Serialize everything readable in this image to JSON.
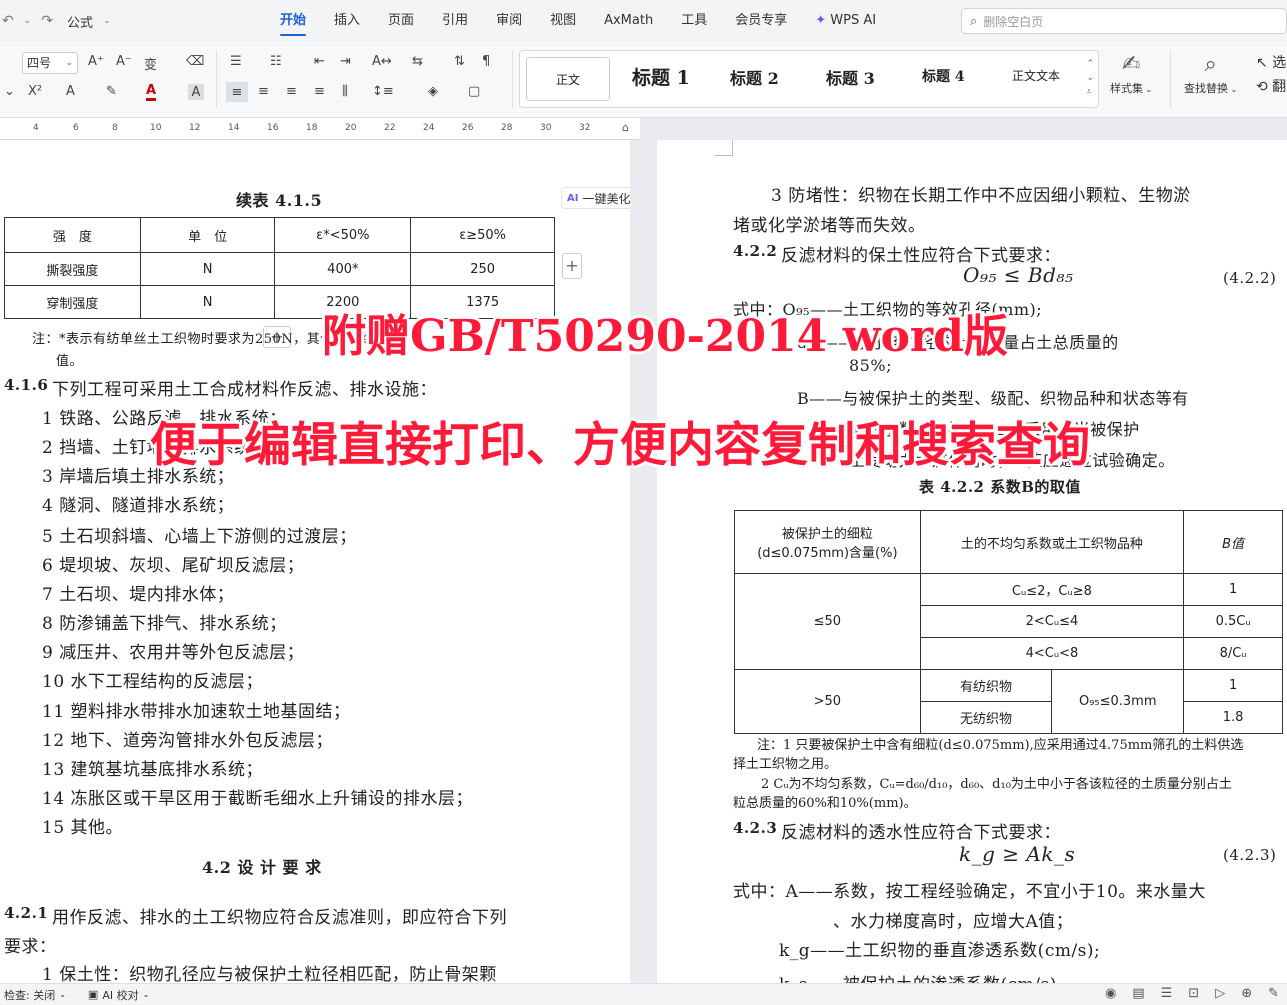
{
  "menubar": {
    "quick_style": "公式",
    "tabs": [
      "开始",
      "插入",
      "页面",
      "引用",
      "审阅",
      "视图",
      "AxMath",
      "工具",
      "会员专享",
      "WPS AI"
    ],
    "active_tab": "开始",
    "search_placeholder": "删除空白页"
  },
  "ribbon": {
    "font_size": "四号",
    "styles": [
      "正文",
      "标题 1",
      "标题 2",
      "标题 3",
      "标题 4",
      "正文文本"
    ],
    "style_set_label": "样式集",
    "find_replace_label": "查找替换",
    "select_label": "选"
  },
  "ruler": {
    "ticks": [
      "4",
      "6",
      "8",
      "10",
      "12",
      "14",
      "16",
      "18",
      "20",
      "22",
      "24",
      "26",
      "28",
      "30",
      "32"
    ]
  },
  "left_page": {
    "table_title": "续表 4.1.5",
    "ai_beautify": "一键美化",
    "table": {
      "headers": [
        "强　度",
        "单　位",
        "ε*<50%",
        "ε≥50%"
      ],
      "rows": [
        [
          "撕裂强度",
          "N",
          "400*",
          "250"
        ],
        [
          "穿制强度",
          "N",
          "2200",
          "1375"
        ]
      ]
    },
    "note_line1": "注：*表示有纺单丝土工织物时要求为250N，其他土工织物…",
    "note_line2": "值。",
    "clause_416_num": "4.1.6",
    "clause_416_text": "下列工程可采用土工合成材料作反滤、排水设施：",
    "items": [
      "1 铁路、公路反滤、排水系统；",
      "2 挡墙、土钉墙等排水系统；",
      "3 岸墙后填土排水系统；",
      "4 隧洞、隧道排水系统；",
      "5 土石坝斜墙、心墙上下游侧的过渡层；",
      "6 堤坝坡、灰坝、尾矿坝反滤层；",
      "7 土石坝、堤内排水体；",
      "8 防渗铺盖下排气、排水系统；",
      "9 减压井、农用井等外包反滤层；",
      "10 水下工程结构的反滤层；",
      "11 塑料排水带排水加速软土地基固结；",
      "12 地下、道旁沟管排水外包反滤层；",
      "13 建筑基坑基底排水系统；",
      "14 冻胀区或干旱区用于截断毛细水上升铺设的排水层；",
      "15 其他。"
    ],
    "section_42": "4.2 设 计 要 求",
    "clause_421_num": "4.2.1",
    "clause_421_text": "用作反滤、排水的土工织物应符合反滤准则，即应符合下列",
    "clause_421_cont": "要求：",
    "item_1": "1 保土性：织物孔径应与被保护土粒径相匹配，防止骨架颗"
  },
  "right_page": {
    "item_3": "3 防堵性：织物在长期工作中不应因细小颗粒、生物淤",
    "item_3_cont": "堵或化学淤堵等而失效。",
    "clause_422_num": "4.2.2",
    "clause_422_text": "反滤材料的保土性应符合下式要求：",
    "formula_422": "O₉₅ ≤ Bd₈₅",
    "formula_422_num": "(4.2.2)",
    "where_1": "式中：O₉₅——土工织物的等效孔径(mm);",
    "where_2": "d₈₅——小于该粒径的土粒质量占土总质量的",
    "where_2_cont": "85%;",
    "where_3": "B——与被保护土的类型、级配、织物品种和状态等有",
    "where_3_cont": "关的系数，应按表4.2.2采用。当被保护",
    "where_3_cont2": "土受动力水流作用时，B值应通过试验确定。",
    "table_title": "表 4.2.2  系数B的取值",
    "table": {
      "h1": "被保护土的细粒",
      "h1b": "(d≤0.075mm)含量(%)",
      "h2": "土的不均匀系数或土工织物品种",
      "h3": "B值",
      "le50": "≤50",
      "gt50": ">50",
      "r1": "Cᵤ≤2，Cᵤ≥8",
      "r1v": "1",
      "r2": "2<Cᵤ≤4",
      "r2v": "0.5Cᵤ",
      "r3": "4<Cᵤ<8",
      "r3v": "8/Cᵤ",
      "woven": "有纺织物",
      "nonwoven": "无纺织物",
      "o95": "O₉₅≤0.3mm",
      "r4v": "1",
      "r5v": "1.8"
    },
    "note_1": "注：1 只要被保护土中含有细粒(d≤0.075mm),应采用通过4.75mm筛孔的土料供选",
    "note_1_cont": "择土工织物之用。",
    "note_2": "2 Cᵤ为不均匀系数，Cᵤ=d₆₀/d₁₀，d₆₀、d₁₀为土中小于各该粒径的土质量分别占土",
    "note_2_cont": "粒总质量的60%和10%(mm)。",
    "clause_423_num": "4.2.3",
    "clause_423_text": "反滤材料的透水性应符合下式要求：",
    "formula_423": "k_g ≥ Ak_s",
    "formula_423_num": "(4.2.3)",
    "where_4": "式中：A——系数，按工程经验确定，不宜小于10。来水量大",
    "where_4_cont": "、水力梯度高时，应增大A值；",
    "where_5": "k_g——土工织物的垂直渗透系数(cm/s);",
    "where_6": "k_s——被保护土的渗透系数(cm/s)。"
  },
  "overlay": {
    "line1": "附赠GB/T50290-2014 word版",
    "line2": "便于编辑直接打印、方便内容复制和搜索查询"
  },
  "statusbar": {
    "spell_check": "检查: 关闭",
    "ai_proof": "AI 校对"
  }
}
